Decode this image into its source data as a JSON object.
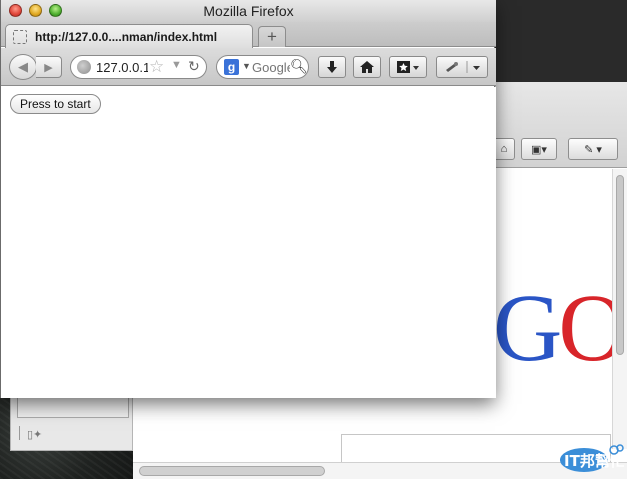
{
  "window": {
    "title": "Mozilla Firefox"
  },
  "tab": {
    "label": "http://127.0.0....nman/index.html"
  },
  "newtab": {
    "label": "+"
  },
  "navbar": {
    "url": "127.0.0.1",
    "search_engine_letter": "g",
    "search_placeholder": "Google"
  },
  "page": {
    "start_button": "Press to start"
  },
  "background": {
    "logo_letter_1": "G",
    "logo_letter_2": "O",
    "watermark_text": "IT邦幫忙"
  }
}
